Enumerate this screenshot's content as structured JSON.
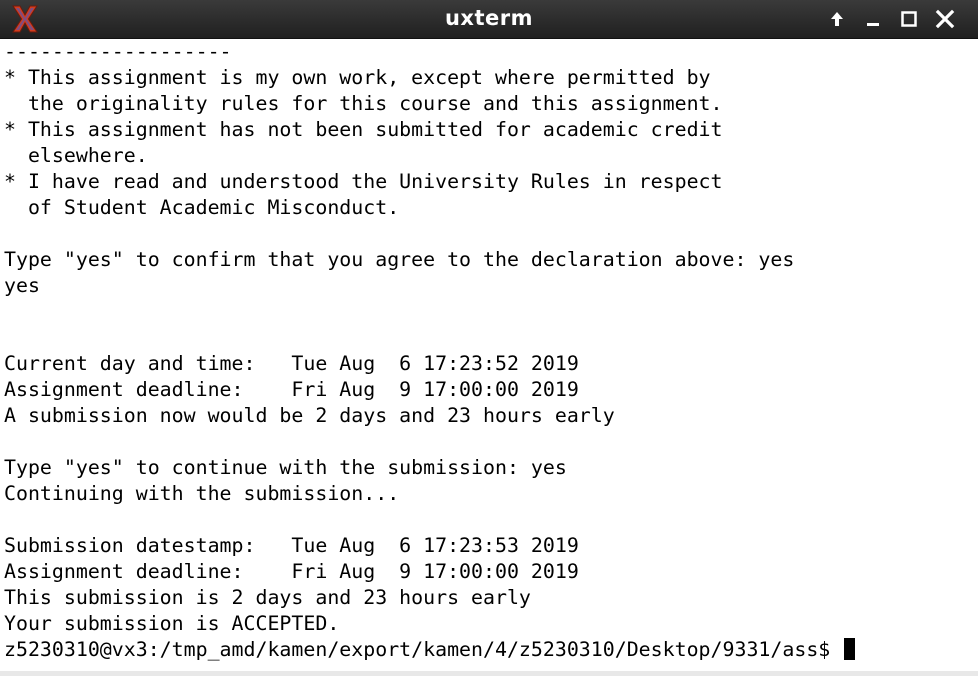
{
  "window": {
    "title": "uxterm"
  },
  "icons": {
    "app_logo": "x-logo-icon",
    "shade": "arrow-up-icon",
    "minimize": "minimize-icon",
    "maximize": "maximize-icon",
    "close": "close-icon"
  },
  "colors": {
    "titlebar": "#2a2a2a",
    "logo": "#d23c1e",
    "terminal_bg": "#ffffff",
    "terminal_fg": "#000000"
  },
  "terminal": {
    "output": "-------------------\n* This assignment is my own work, except where permitted by\n  the originality rules for this course and this assignment.\n* This assignment has not been submitted for academic credit\n  elsewhere.\n* I have read and understood the University Rules in respect\n  of Student Academic Misconduct.\n\nType \"yes\" to confirm that you agree to the declaration above: yes\nyes\n\n\nCurrent day and time:   Tue Aug  6 17:23:52 2019\nAssignment deadline:    Fri Aug  9 17:00:00 2019\nA submission now would be 2 days and 23 hours early\n\nType \"yes\" to continue with the submission: yes\nContinuing with the submission...\n\nSubmission datestamp:   Tue Aug  6 17:23:53 2019\nAssignment deadline:    Fri Aug  9 17:00:00 2019\nThis submission is 2 days and 23 hours early\nYour submission is ACCEPTED.",
    "prompt": "z5230310@vx3:/tmp_amd/kamen/export/kamen/4/z5230310/Desktop/9331/ass$ "
  }
}
